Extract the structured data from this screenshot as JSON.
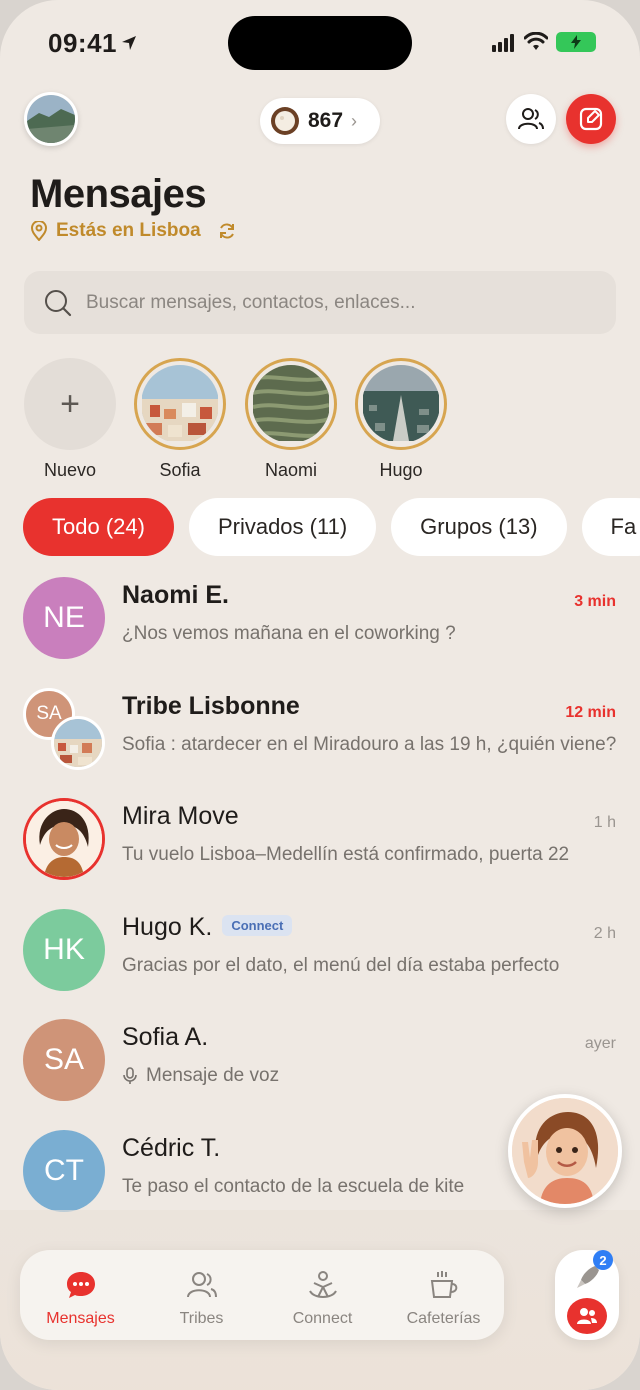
{
  "status": {
    "time": "09:41"
  },
  "header": {
    "coins": "867",
    "coins_chevron": "›",
    "title": "Mensajes",
    "location": "Estás en Lisboa"
  },
  "search": {
    "placeholder": "Buscar mensajes, contactos, enlaces..."
  },
  "stories": {
    "new_label": "Nuevo",
    "new_symbol": "+",
    "items": [
      {
        "name": "Sofia"
      },
      {
        "name": "Naomi"
      },
      {
        "name": "Hugo"
      }
    ]
  },
  "filters": [
    {
      "label": "Todo (24)",
      "active": true
    },
    {
      "label": "Privados (11)"
    },
    {
      "label": "Grupos (13)"
    },
    {
      "label": "Fa"
    }
  ],
  "conversations": [
    {
      "initials": "NE",
      "name": "Naomi E.",
      "message": "¿Nos vemos mañana en el coworking ?",
      "time": "3 min",
      "color": "#c97fbd"
    },
    {
      "initials": "SA",
      "name": "Tribe Lisbonne",
      "message": "Sofia : atardecer en el Miradouro a las 19 h, ¿quién viene?",
      "time": "12 min"
    },
    {
      "name": "Mira Move",
      "message": "Tu vuelo Lisboa–Medellín está confirmado, puerta 22",
      "time": "1 h"
    },
    {
      "initials": "HK",
      "name": "Hugo K.",
      "badge": "Connect",
      "message": "Gracias por el dato, el menú del día estaba perfecto",
      "time": "2 h",
      "color": "#7ccb9d"
    },
    {
      "initials": "SA",
      "name": "Sofia A.",
      "message": "Mensaje de voz",
      "time": "ayer",
      "color": "#cf9478"
    },
    {
      "initials": "CT",
      "name": "Cédric T.",
      "message": "Te paso el contacto de la escuela de kite",
      "color": "#7aaed2"
    }
  ],
  "tabs": [
    {
      "label": "Mensajes",
      "icon": "chat-bubble-icon",
      "active": true
    },
    {
      "label": "Tribes",
      "icon": "people-icon"
    },
    {
      "label": "Connect",
      "icon": "connect-icon"
    },
    {
      "label": "Cafeterías",
      "icon": "coffee-icon"
    }
  ],
  "side_badge": "2",
  "colors": {
    "accent": "#e8322e",
    "gold": "#d7a550",
    "location": "#c08a2b"
  }
}
